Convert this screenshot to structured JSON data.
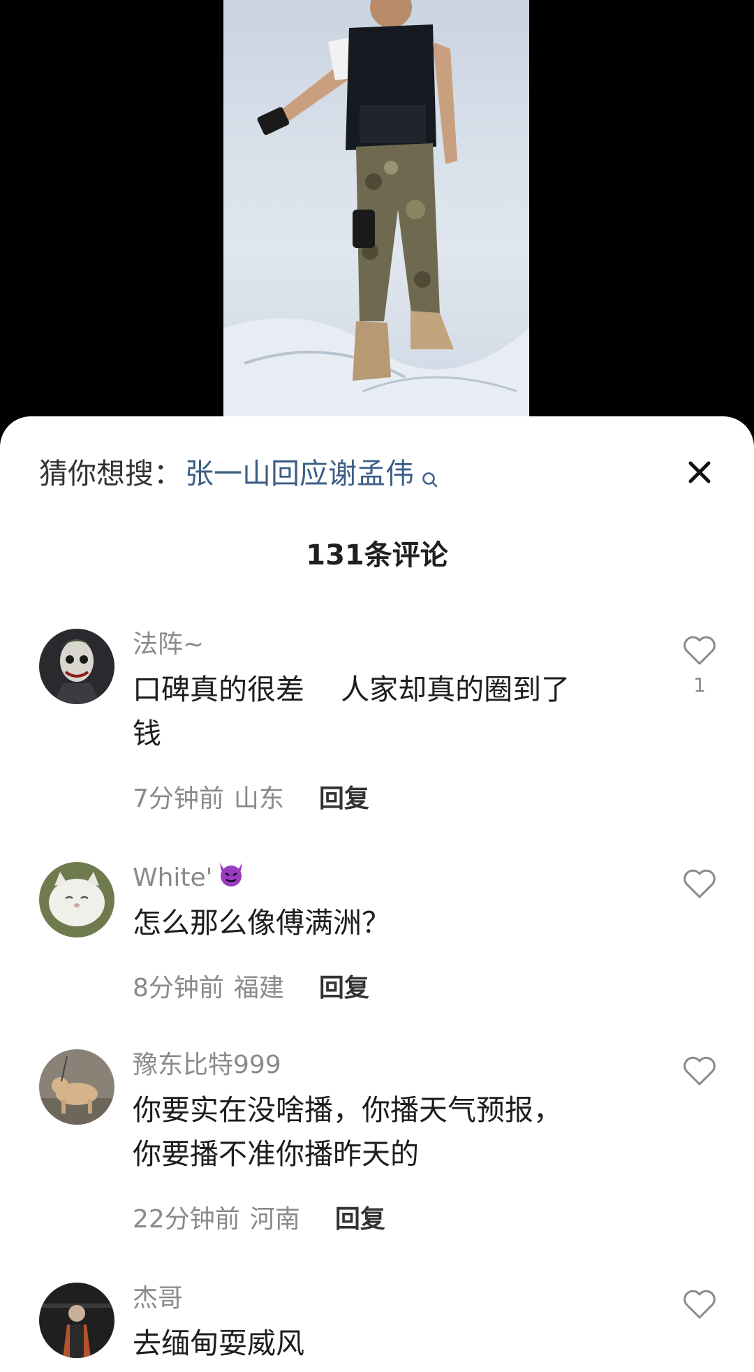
{
  "search_suggest": {
    "prefix": "猜你想搜：",
    "term": "张一山回应谢孟伟"
  },
  "comment_count_label": "131条评论",
  "comments": [
    {
      "username": "法阵~",
      "text": "口碑真的很差    人家却真的圈到了\n钱",
      "time": "7分钟前",
      "region": "山东",
      "reply_label": "回复",
      "likes": "1",
      "avatar_icon": "joker-avatar"
    },
    {
      "username": "White'",
      "username_emoji_icon": "smiling-devil-emoji",
      "text": "怎么那么像傅满洲？",
      "time": "8分钟前",
      "region": "福建",
      "reply_label": "回复",
      "avatar_icon": "white-cat-avatar"
    },
    {
      "username": "豫东比特999",
      "text": "你要实在没啥播，你播天气预报，\n你要播不准你播昨天的",
      "time": "22分钟前",
      "region": "河南",
      "reply_label": "回复",
      "avatar_icon": "dog-avatar"
    },
    {
      "username": "杰哥",
      "text": "去缅甸耍威风",
      "avatar_icon": "person-dark-avatar"
    }
  ],
  "colors": {
    "link_blue": "#3d5f86",
    "meta_gray": "#8a8a8a",
    "text_dark": "#1d1d1d",
    "devil_purple": "#9b3bbf"
  }
}
